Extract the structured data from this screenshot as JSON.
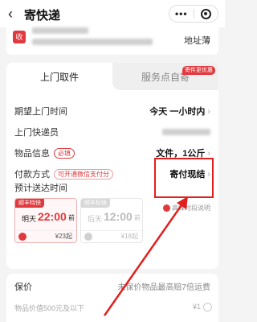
{
  "header": {
    "back_icon": "chevron-left-icon",
    "title": "寄快递",
    "capsule_dots": "•••",
    "capsule_target_icon": "target-icon"
  },
  "receiver": {
    "tag": "收",
    "address_book": "地址薄"
  },
  "tabs": {
    "active": "上门取件",
    "inactive": "服务点自寄",
    "badge": "寄件更优惠"
  },
  "rows": {
    "pickup_time": {
      "label": "期望上门时间",
      "value": "今天 一小时内"
    },
    "courier": {
      "label": "上门快递员"
    },
    "item_info": {
      "label": "物品信息",
      "required": "必填",
      "value": "文件，1公斤"
    },
    "payment": {
      "label": "付款方式",
      "hint": "可开通微信支付分",
      "value": "寄付现结"
    }
  },
  "eta": {
    "label": "预计送达时间",
    "help": "高峰时段说明"
  },
  "options": [
    {
      "tag": "顺丰特快",
      "day": "明天",
      "time": "22:00",
      "suffix": "前",
      "price": "¥23起"
    },
    {
      "tag": "顺丰标快",
      "day": "后天",
      "time": "12:00",
      "suffix": "前",
      "price": "¥18起"
    }
  ],
  "insurance": {
    "title": "保价",
    "note": "未保价物品最高赔7倍运费",
    "sub": "物品价值500元及以下",
    "price": "¥1"
  },
  "colors": {
    "accent": "#e0393e",
    "annotation": "#e0201e"
  }
}
